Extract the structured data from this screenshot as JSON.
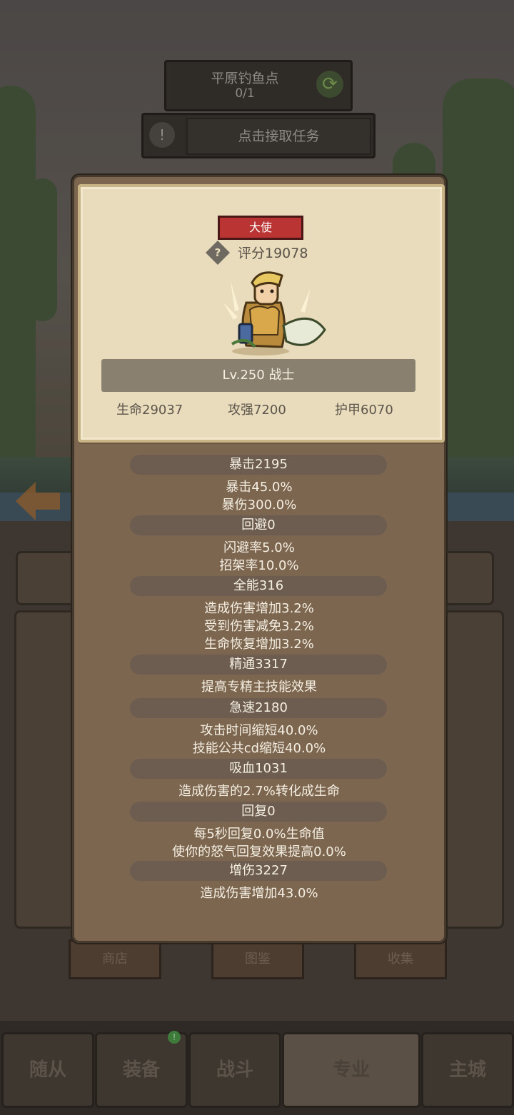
{
  "location": {
    "name": "平原钓鱼点",
    "progress": "0/1"
  },
  "quest": {
    "button_label": "点击接取任务"
  },
  "character": {
    "title_badge": "大使",
    "score": "评分19078",
    "level_class": "Lv.250 战士",
    "hp": "生命29037",
    "attack": "攻强7200",
    "armor": "护甲6070"
  },
  "stats": [
    {
      "header": "暴击2195",
      "lines": [
        "暴击45.0%",
        "暴伤300.0%"
      ]
    },
    {
      "header": "回避0",
      "lines": [
        "闪避率5.0%",
        "招架率10.0%"
      ]
    },
    {
      "header": "全能316",
      "lines": [
        "造成伤害增加3.2%",
        "受到伤害减免3.2%",
        "生命恢复增加3.2%"
      ]
    },
    {
      "header": "精通3317",
      "lines": [
        "提高专精主技能效果"
      ]
    },
    {
      "header": "急速2180",
      "lines": [
        "攻击时间缩短40.0%",
        "技能公共cd缩短40.0%"
      ]
    },
    {
      "header": "吸血1031",
      "lines": [
        "造成伤害的2.7%转化成生命"
      ]
    },
    {
      "header": "回复0",
      "lines": [
        "每5秒回复0.0%生命值",
        "使你的怒气回复效果提高0.0%"
      ]
    },
    {
      "header": "增伤3227",
      "lines": [
        "造成伤害增加43.0%"
      ]
    }
  ],
  "lower_buttons": {
    "shop": "商店",
    "codex": "图鉴",
    "collection": "收集"
  },
  "nav": [
    {
      "label": "随从"
    },
    {
      "label": "装备",
      "badge": "!"
    },
    {
      "label": "战斗"
    },
    {
      "label": "专业"
    },
    {
      "label": "主城"
    }
  ],
  "colors": {
    "badge_red": "#b93432",
    "parchment": "#e9dcbc",
    "panel_brown": "#7c6650"
  },
  "icons": {
    "refresh": "refresh-icon",
    "quest": "exclamation-icon",
    "help": "question-diamond-icon",
    "back": "back-arrow-icon"
  }
}
